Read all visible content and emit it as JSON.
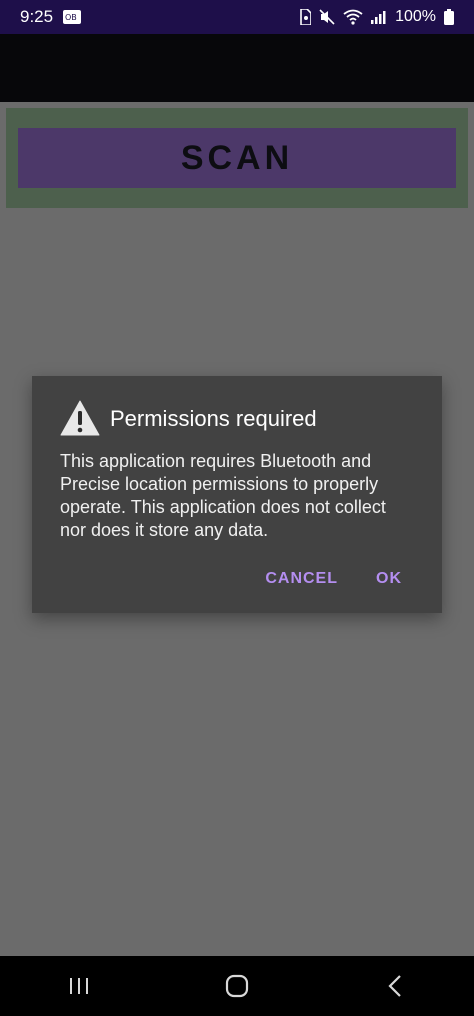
{
  "status_bar": {
    "time": "9:25",
    "battery": "100%",
    "icons": [
      "notification-icon",
      "sim-icon",
      "mute-icon",
      "wifi-icon",
      "signal-icon",
      "battery-icon"
    ]
  },
  "main": {
    "scan_button_label": "SCAN",
    "colors": {
      "scan_frame": "#4d604d",
      "scan_button": "#4c3869"
    }
  },
  "dialog": {
    "icon": "warning-icon",
    "title": "Permissions required",
    "message": "This application requires Bluetooth and Precise location permissions to properly operate. This application does not collect nor does it store any data.",
    "cancel_label": "CANCEL",
    "ok_label": "OK",
    "accent_color": "#b48ef0"
  },
  "nav_bar": {
    "buttons": [
      "recent-apps-icon",
      "home-icon",
      "back-icon"
    ]
  }
}
